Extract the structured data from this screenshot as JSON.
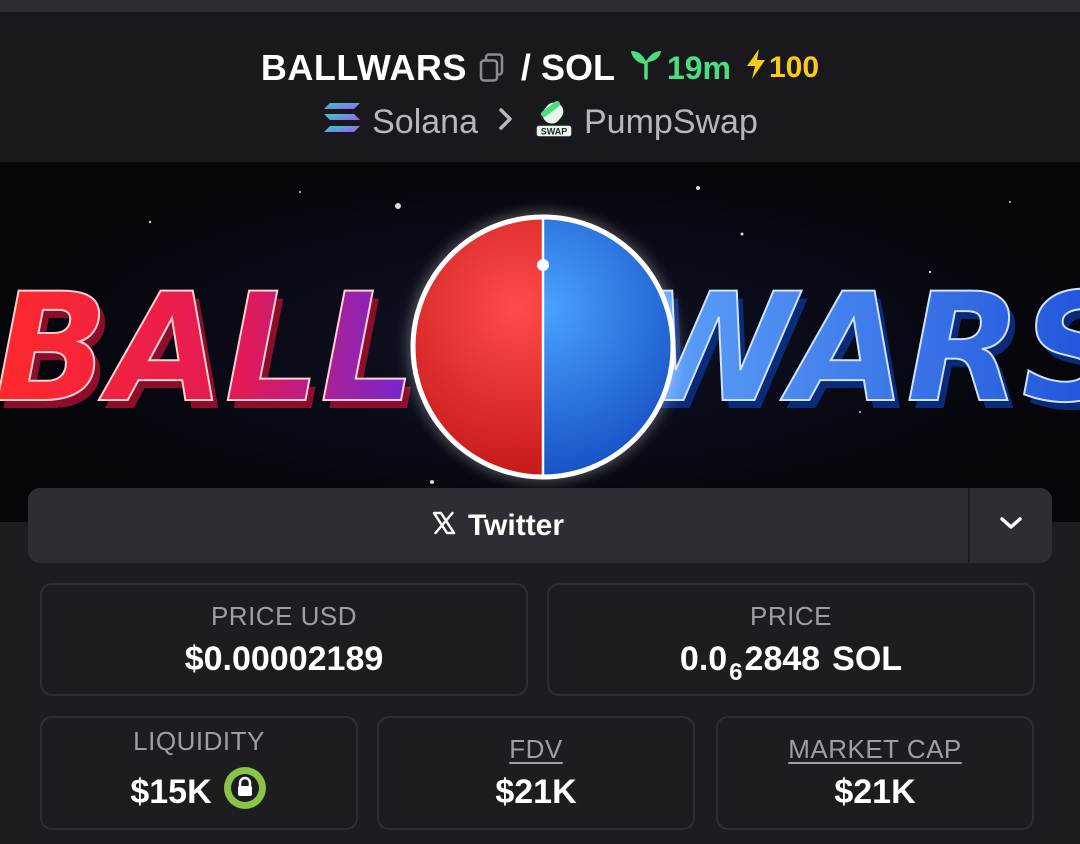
{
  "header": {
    "token_name": "BALLWARS",
    "pair_separator": "/",
    "quote_token": "SOL",
    "age": "19m",
    "boost": "100",
    "chain": "Solana",
    "dex": "PumpSwap",
    "dex_badge": "SWAP",
    "colors": {
      "age": "#4ade80",
      "boost": "#facc15"
    }
  },
  "banner": {
    "word_left": "BALL",
    "word_right": "WARS"
  },
  "social": {
    "twitter_label": "Twitter",
    "icons": {
      "twitter": "x-logo-icon",
      "dropdown": "chevron-down-icon"
    }
  },
  "stats": {
    "price_usd_label": "PRICE USD",
    "price_usd_value": "$0.00002189",
    "price_label": "PRICE",
    "price_prefix": "0.0",
    "price_zeros": "6",
    "price_digits": "2848",
    "price_unit": "SOL",
    "liquidity_label": "LIQUIDITY",
    "liquidity_value": "$15K",
    "fdv_label": "FDV",
    "fdv_value": "$21K",
    "mcap_label": "MARKET CAP",
    "mcap_value": "$21K"
  }
}
